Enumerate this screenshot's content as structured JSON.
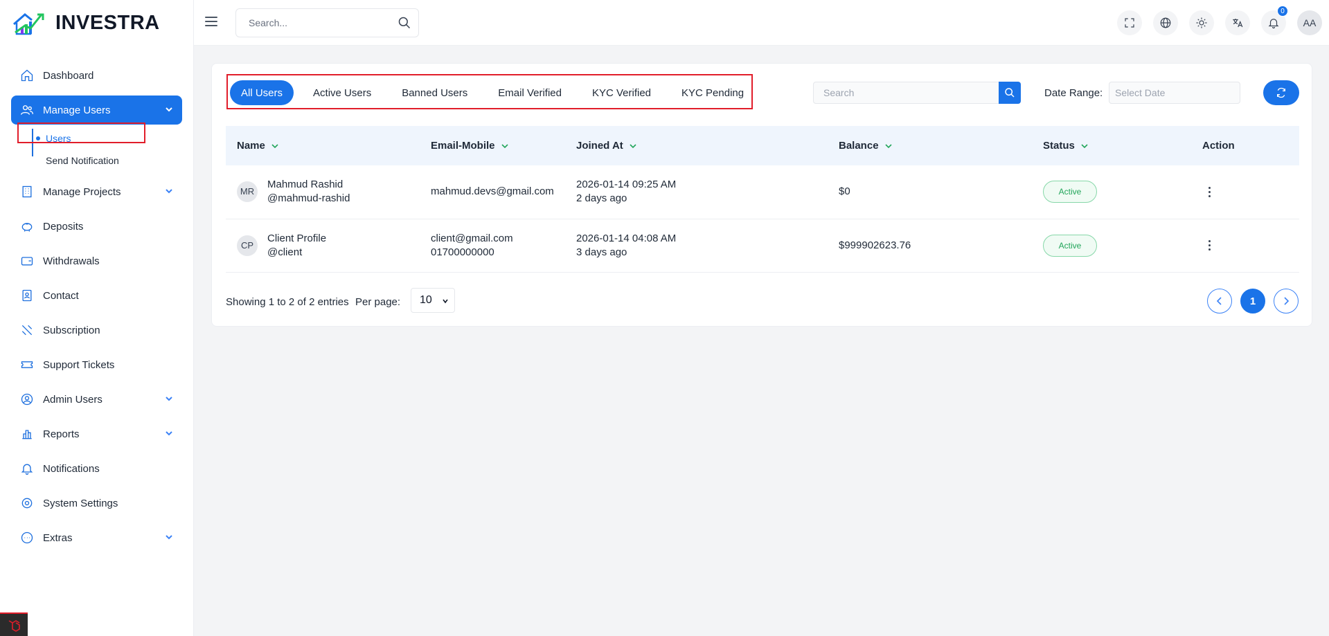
{
  "brand": {
    "name": "INVESTRA"
  },
  "sidebar": {
    "items": [
      {
        "label": "Dashboard",
        "icon": "home-icon"
      },
      {
        "label": "Manage Users",
        "icon": "users-icon",
        "active": true,
        "sub": [
          {
            "label": "Users",
            "active": true
          },
          {
            "label": "Send Notification"
          }
        ]
      },
      {
        "label": "Manage Projects",
        "icon": "building-icon",
        "has_children": true
      },
      {
        "label": "Deposits",
        "icon": "piggy-bank-icon"
      },
      {
        "label": "Withdrawals",
        "icon": "wallet-icon"
      },
      {
        "label": "Contact",
        "icon": "contact-icon"
      },
      {
        "label": "Subscription",
        "icon": "subscription-icon"
      },
      {
        "label": "Support Tickets",
        "icon": "ticket-icon"
      },
      {
        "label": "Admin Users",
        "icon": "user-circle-icon",
        "has_children": true
      },
      {
        "label": "Reports",
        "icon": "bar-chart-icon",
        "has_children": true
      },
      {
        "label": "Notifications",
        "icon": "bell-icon"
      },
      {
        "label": "System Settings",
        "icon": "gear-icon"
      },
      {
        "label": "Extras",
        "icon": "dots-circle-icon",
        "has_children": true
      }
    ]
  },
  "topbar": {
    "search_placeholder": "Search...",
    "notification_count": "0",
    "avatar_initials": "AA"
  },
  "filters": {
    "tabs": [
      "All Users",
      "Active Users",
      "Banned Users",
      "Email Verified",
      "KYC Verified",
      "KYC Pending"
    ],
    "active_tab": "All Users",
    "search_placeholder": "Search",
    "date_range_label": "Date Range:",
    "date_placeholder": "Select Date"
  },
  "table": {
    "headers": [
      "Name",
      "Email-Mobile",
      "Joined At",
      "Balance",
      "Status",
      "Action"
    ],
    "rows": [
      {
        "initials": "MR",
        "name": "Mahmud Rashid",
        "username": "@mahmud-rashid",
        "email": "mahmud.devs@gmail.com",
        "mobile": "",
        "joined": "2026-01-14 09:25 AM",
        "joined_ago": "2 days ago",
        "balance": "$0",
        "status": "Active"
      },
      {
        "initials": "CP",
        "name": "Client Profile",
        "username": "@client",
        "email": "client@gmail.com",
        "mobile": "01700000000",
        "joined": "2026-01-14 04:08 AM",
        "joined_ago": "3 days ago",
        "balance": "$999902623.76",
        "status": "Active"
      }
    ]
  },
  "pagination": {
    "info": "Showing 1 to 2 of 2 entries",
    "per_page_label": "Per page:",
    "per_page_value": "10",
    "current_page": "1"
  },
  "colors": {
    "primary": "#1a73e8",
    "highlight": "#e11d2a",
    "active_green": "#22a55a"
  }
}
